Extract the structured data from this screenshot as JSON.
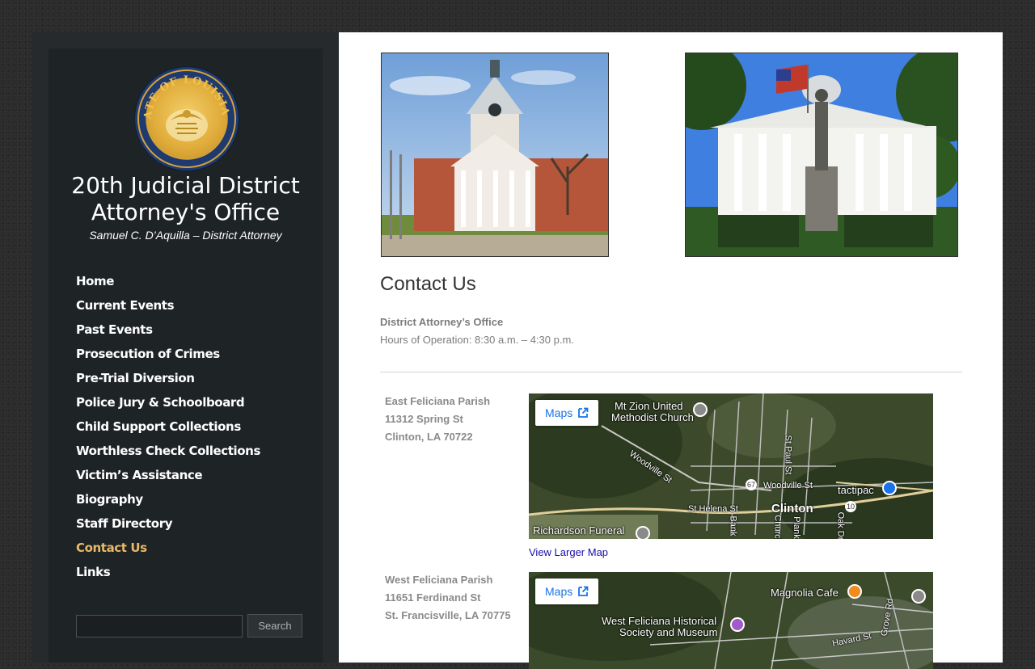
{
  "site": {
    "seal_text": "STATE OF LOUISIANA",
    "title_line1": "20th Judicial District",
    "title_line2": "Attorney's Office",
    "subtitle": "Samuel C. D’Aquilla – District Attorney"
  },
  "nav": {
    "items": [
      {
        "label": "Home",
        "active": false
      },
      {
        "label": "Current Events",
        "active": false
      },
      {
        "label": "Past Events",
        "active": false
      },
      {
        "label": "Prosecution of Crimes",
        "active": false
      },
      {
        "label": "Pre-Trial Diversion",
        "active": false
      },
      {
        "label": "Police Jury & Schoolboard",
        "active": false
      },
      {
        "label": "Child Support Collections",
        "active": false
      },
      {
        "label": "Worthless Check Collections",
        "active": false
      },
      {
        "label": "Victim’s Assistance",
        "active": false
      },
      {
        "label": "Biography",
        "active": false
      },
      {
        "label": "Staff Directory",
        "active": false
      },
      {
        "label": "Contact Us",
        "active": true
      },
      {
        "label": "Links",
        "active": false
      }
    ],
    "active_color": "#e8b96a"
  },
  "search": {
    "input_value": "",
    "button_label": "Search"
  },
  "main": {
    "page_title": "Contact Us",
    "office_name": "District Attorney’s Office",
    "hours": "Hours of Operation: 8:30 a.m. – 4:30 p.m.",
    "locations": [
      {
        "parish": "East Feliciana Parish",
        "street": "11312 Spring St",
        "city": "Clinton, LA 70722",
        "map": {
          "button_label": "Maps",
          "labels": [
            "Mt Zion United",
            "Methodist Church",
            "Woodville St",
            "Woodville St",
            "tactipac",
            "St Helena St",
            "Clinton",
            "Richardson Funeral",
            "St Paul St",
            "Bank",
            "Plank",
            "Oak Dr",
            "Church"
          ],
          "route_numbers": [
            "67",
            "10"
          ]
        },
        "larger_map_link": "View Larger Map"
      },
      {
        "parish": "West Feliciana Parish",
        "street": "11651 Ferdinand St",
        "city": "St. Francisville, LA 70775",
        "map": {
          "button_label": "Maps",
          "labels": [
            "Magnolia Cafe",
            "West Feliciana Historical",
            "Society and Museum",
            "Havard St",
            "Grove Rd"
          ]
        }
      }
    ]
  },
  "colors": {
    "sidebar_bg": "#1e2325",
    "link": "#1a0dab",
    "maps_button_text": "#1a73e8"
  }
}
